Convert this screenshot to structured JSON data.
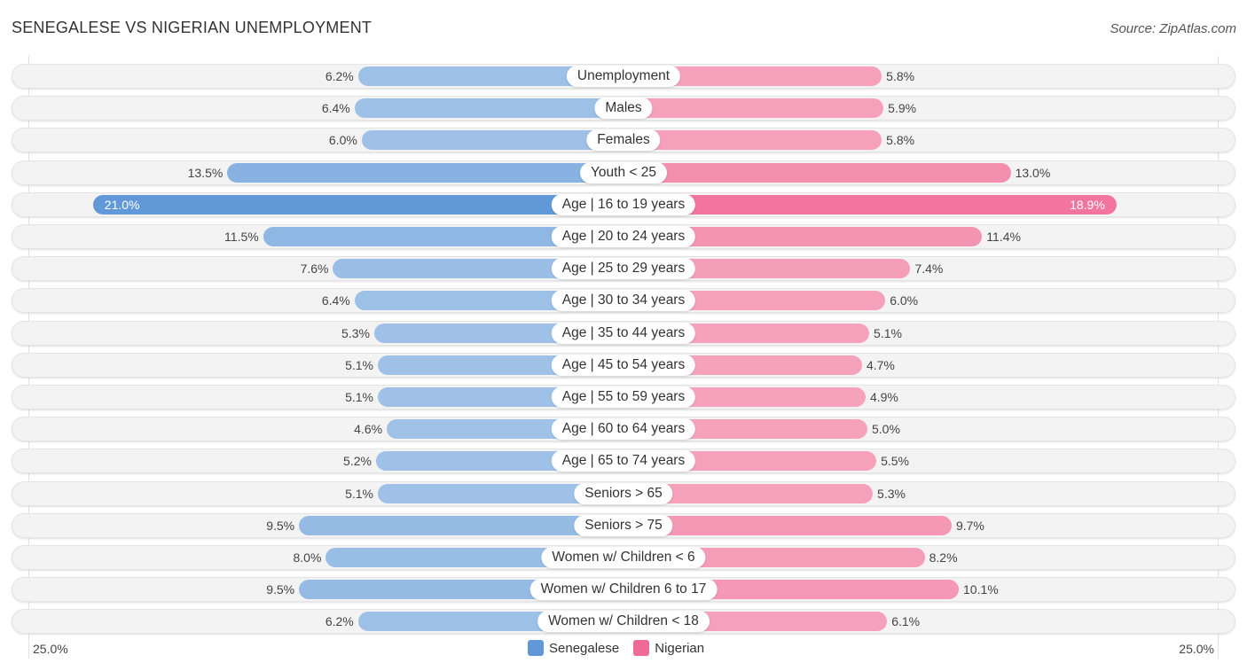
{
  "header": {
    "title": "SENEGALESE VS NIGERIAN UNEMPLOYMENT",
    "source": "Source: ZipAtlas.com"
  },
  "colors": {
    "senegalese_light": "#a3c4e8",
    "senegalese_strong": "#6199d8",
    "nigerian_light": "#f6a5bf",
    "nigerian_strong": "#f06a96"
  },
  "chart_data": {
    "type": "bar",
    "orientation": "horizontal-diverging",
    "title": "SENEGALESE VS NIGERIAN UNEMPLOYMENT",
    "categories": [
      "Unemployment",
      "Males",
      "Females",
      "Youth < 25",
      "Age | 16 to 19 years",
      "Age | 20 to 24 years",
      "Age | 25 to 29 years",
      "Age | 30 to 34 years",
      "Age | 35 to 44 years",
      "Age | 45 to 54 years",
      "Age | 55 to 59 years",
      "Age | 60 to 64 years",
      "Age | 65 to 74 years",
      "Seniors > 65",
      "Seniors > 75",
      "Women w/ Children < 6",
      "Women w/ Children 6 to 17",
      "Women w/ Children < 18"
    ],
    "series": [
      {
        "name": "Senegalese",
        "side": "left",
        "values": [
          6.2,
          6.4,
          6.0,
          13.5,
          21.0,
          11.5,
          7.6,
          6.4,
          5.3,
          5.1,
          5.1,
          4.6,
          5.2,
          5.1,
          9.5,
          8.0,
          9.5,
          6.2
        ]
      },
      {
        "name": "Nigerian",
        "side": "right",
        "values": [
          5.8,
          5.9,
          5.8,
          13.0,
          18.9,
          11.4,
          7.4,
          6.0,
          5.1,
          4.7,
          4.9,
          5.0,
          5.5,
          5.3,
          9.7,
          8.2,
          10.1,
          6.1
        ]
      }
    ],
    "value_format": "{v}%",
    "axis": {
      "min_label": "25.0%",
      "max_label": "25.0%",
      "range": [
        0,
        25
      ]
    },
    "legend": {
      "position": "bottom-center",
      "entries": [
        "Senegalese",
        "Nigerian"
      ]
    },
    "highlighted_row": "Age | 16 to 19 years"
  }
}
